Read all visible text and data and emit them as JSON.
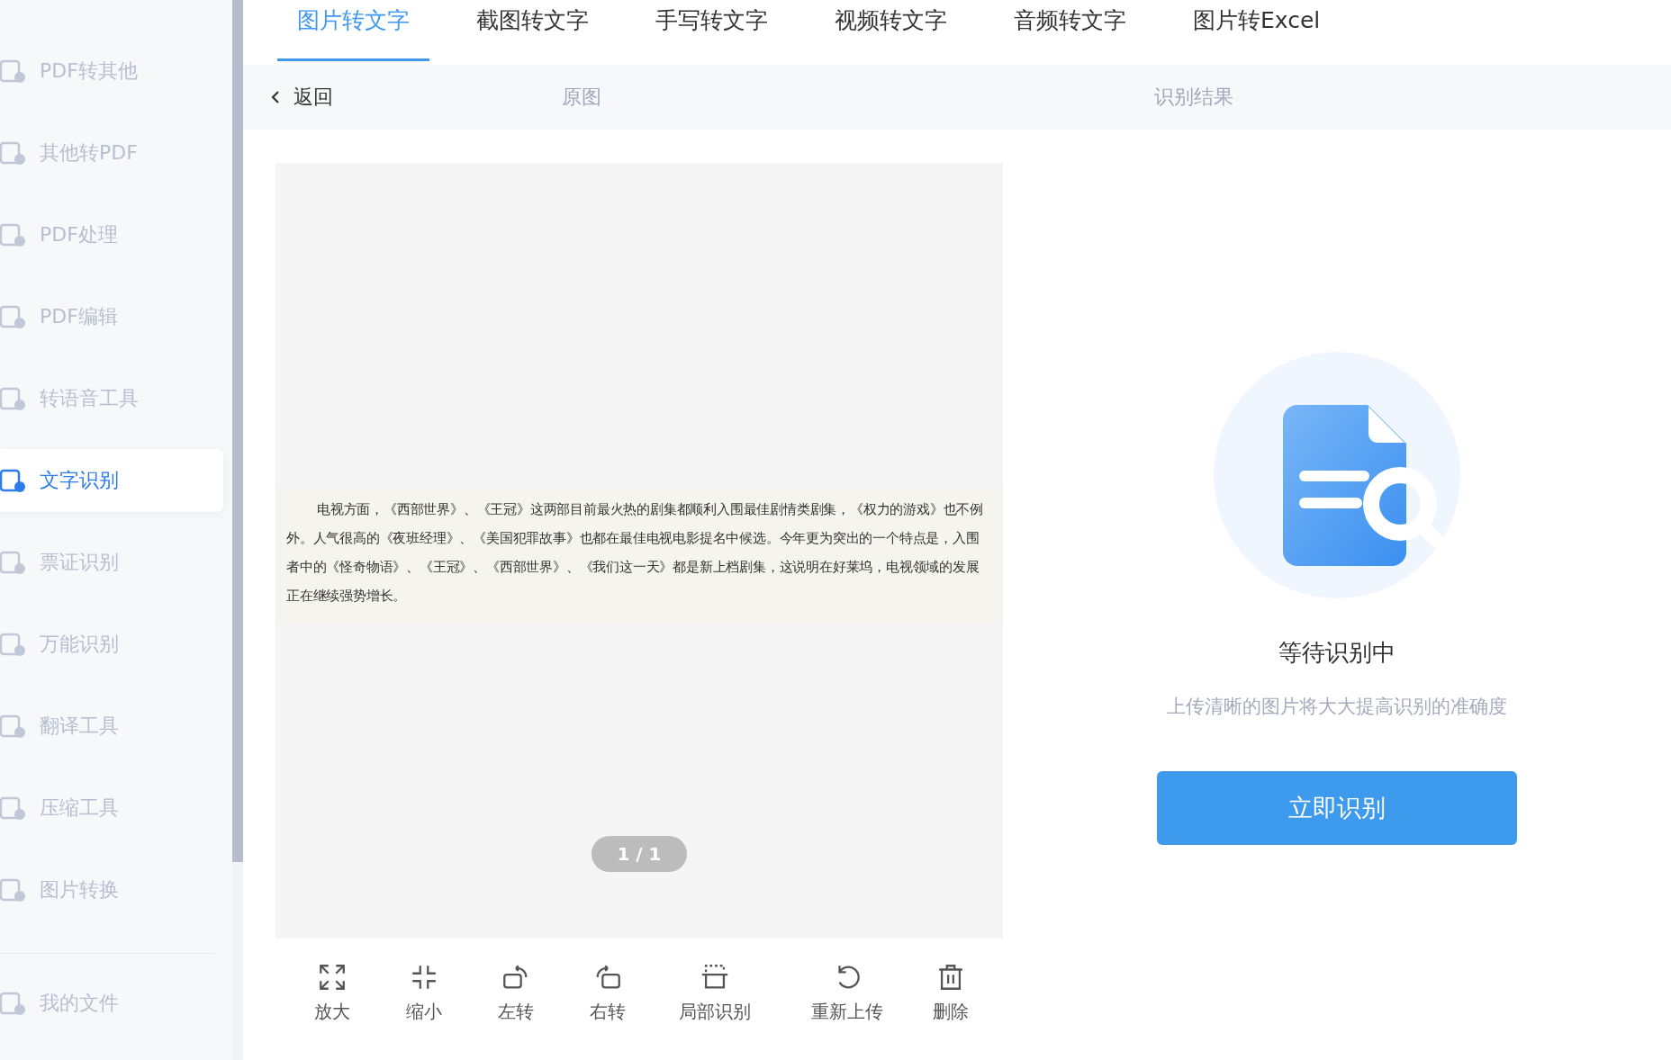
{
  "sidebar": {
    "items": [
      {
        "label": "PDF转其他",
        "selected": false
      },
      {
        "label": "其他转PDF",
        "selected": false
      },
      {
        "label": "PDF处理",
        "selected": false
      },
      {
        "label": "PDF编辑",
        "selected": false
      },
      {
        "label": "转语音工具",
        "selected": false
      },
      {
        "label": "文字识别",
        "selected": true
      },
      {
        "label": "票证识别",
        "selected": false
      },
      {
        "label": "万能识别",
        "selected": false
      },
      {
        "label": "翻译工具",
        "selected": false
      },
      {
        "label": "压缩工具",
        "selected": false
      },
      {
        "label": "图片转换",
        "selected": false
      }
    ],
    "footer_item": {
      "label": "我的文件"
    }
  },
  "tabs": [
    {
      "label": "图片转文字",
      "selected": true
    },
    {
      "label": "截图转文字",
      "selected": false
    },
    {
      "label": "手写转文字",
      "selected": false
    },
    {
      "label": "视频转文字",
      "selected": false
    },
    {
      "label": "音频转文字",
      "selected": false
    },
    {
      "label": "图片转Excel",
      "selected": false
    }
  ],
  "subheader": {
    "back": "返回",
    "left_title": "原图",
    "right_title": "识别结果"
  },
  "preview": {
    "text": "电视方面，《西部世界》、《王冠》这两部目前最火热的剧集都顺利入围最佳剧情类剧集，《权力的游戏》也不例外。人气很高的《夜班经理》、《美国犯罪故事》也都在最佳电视电影提名中候选。今年更为突出的一个特点是，入围者中的《怪奇物语》、《王冠》、《西部世界》、《我们这一天》都是新上档剧集，这说明在好莱坞，电视领域的发展正在继续强势增长。",
    "page": "1 / 1"
  },
  "toolbar": [
    {
      "label": "放大"
    },
    {
      "label": "缩小"
    },
    {
      "label": "左转"
    },
    {
      "label": "右转"
    },
    {
      "label": "局部识别"
    },
    {
      "label": "重新上传"
    },
    {
      "label": "删除"
    }
  ],
  "result": {
    "status": "等待识别中",
    "hint": "上传清晰的图片将大大提高识别的准确度",
    "button": "立即识别"
  }
}
